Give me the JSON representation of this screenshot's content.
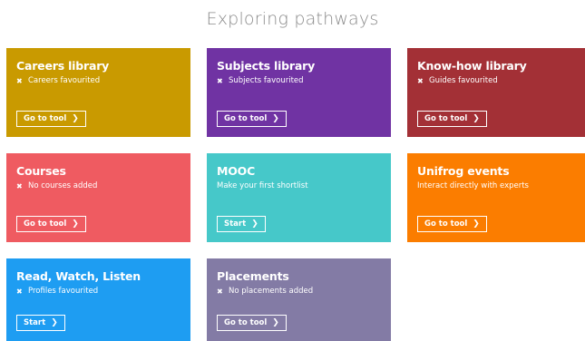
{
  "page": {
    "title": "Exploring pathways"
  },
  "cards": [
    {
      "title": "Careers library",
      "status": "Careers favourited",
      "has_x": true,
      "button": "Go to tool",
      "color": "#c99a00"
    },
    {
      "title": "Subjects library",
      "status": "Subjects favourited",
      "has_x": true,
      "button": "Go to tool",
      "color": "#7033a3"
    },
    {
      "title": "Know-how library",
      "status": "Guides favourited",
      "has_x": true,
      "button": "Go to tool",
      "color": "#a33036"
    },
    {
      "title": "Courses",
      "status": "No courses added",
      "has_x": true,
      "button": "Go to tool",
      "color": "#ef5b61"
    },
    {
      "title": "MOOC",
      "status": "Make your first shortlist",
      "has_x": false,
      "button": "Start",
      "color": "#46c8c9"
    },
    {
      "title": "Unifrog events",
      "status": "Interact directly with experts",
      "has_x": false,
      "button": "Go to tool",
      "color": "#fb7d00"
    },
    {
      "title": "Read, Watch, Listen",
      "status": "Profiles favourited",
      "has_x": true,
      "button": "Start",
      "color": "#1e9df2"
    },
    {
      "title": "Placements",
      "status": "No placements added",
      "has_x": true,
      "button": "Go to tool",
      "color": "#837ba5"
    }
  ],
  "icons": {
    "x": "✖",
    "chevron": "❯"
  }
}
